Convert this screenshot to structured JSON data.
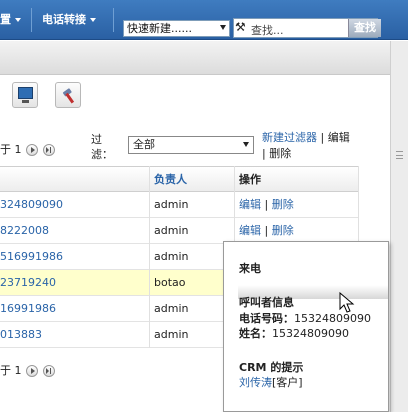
{
  "nav": {
    "menu1": "置",
    "menu2": "电话转接",
    "quick_create": "快速新建......",
    "search_placeholder": "查找...",
    "search_button": "查找"
  },
  "toolbar": {
    "monitor_icon": "monitor-icon",
    "tools_icon": "tools-icon"
  },
  "pager": {
    "page_text": "于 1"
  },
  "filter": {
    "label": "过滤：",
    "selected": "全部",
    "new_filter": "新建过滤器",
    "edit": "编辑",
    "delete": "删除"
  },
  "table": {
    "headers": [
      "",
      "负责人",
      "操作"
    ],
    "rows": [
      {
        "number": "324809090",
        "owner": "admin",
        "edit": "编辑",
        "delete": "删除"
      },
      {
        "number": "8222008",
        "owner": "admin",
        "edit": "编辑",
        "delete": "删除"
      },
      {
        "number": "516991986",
        "owner": "admin",
        "edit": "",
        "delete": ""
      },
      {
        "number": "23719240",
        "owner": "botao",
        "edit": "",
        "delete": ""
      },
      {
        "number": "16991986",
        "owner": "admin",
        "edit": "",
        "delete": ""
      },
      {
        "number": "013883",
        "owner": "admin",
        "edit": "",
        "delete": ""
      }
    ]
  },
  "pager_bottom": {
    "page_text": "于 1"
  },
  "popup": {
    "title": "来电",
    "caller_heading": "呼叫者信息",
    "phone_label": "电话号码：",
    "phone_value": "15324809090",
    "name_label": "姓名：",
    "name_value": "15324809090",
    "crm_heading": "CRM 的提示",
    "contact_name": "刘传涛",
    "contact_type": "[客户]"
  },
  "colors": {
    "nav_bg": "#2a60a3",
    "link": "#2a64a8",
    "highlight_row": "#ffffcc"
  }
}
